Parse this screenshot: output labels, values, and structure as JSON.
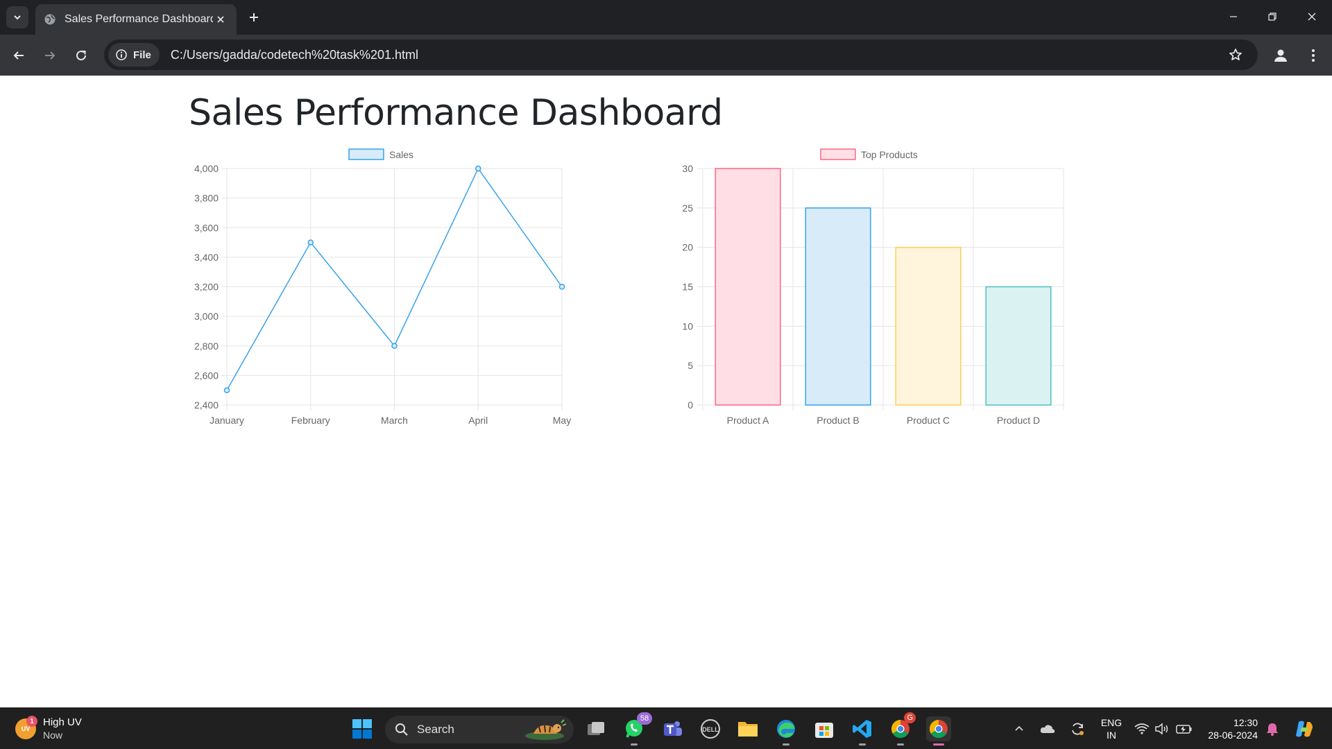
{
  "browser": {
    "tab_title": "Sales Performance Dashboard",
    "site_chip_label": "File",
    "url": "C:/Users/gadda/codetech%20task%201.html"
  },
  "page": {
    "title": "Sales Performance Dashboard"
  },
  "chart_data": [
    {
      "type": "line",
      "x": [
        "January",
        "February",
        "March",
        "April",
        "May"
      ],
      "series": [
        {
          "name": "Sales",
          "values": [
            2500,
            3500,
            2800,
            4000,
            3200
          ],
          "color": "#36a2eb"
        }
      ],
      "ylim": [
        2400,
        4000
      ],
      "yticks": [
        "4,000",
        "3,800",
        "3,600",
        "3,400",
        "3,200",
        "3,000",
        "2,800",
        "2,600",
        "2,400"
      ],
      "legend": "top-center",
      "grid": true
    },
    {
      "type": "bar",
      "categories": [
        "Product A",
        "Product B",
        "Product C",
        "Product D"
      ],
      "series": [
        {
          "name": "Top Products",
          "values": [
            30,
            25,
            20,
            15
          ]
        }
      ],
      "bar_colors": [
        "#ff6384",
        "#36a2eb",
        "#ffce56",
        "#4bc0c0"
      ],
      "bar_fills": [
        "#ffdfe5",
        "#d7ebf9",
        "#fff4dc",
        "#dbf2f2"
      ],
      "ylim": [
        0,
        30
      ],
      "yticks": [
        "30",
        "25",
        "20",
        "15",
        "10",
        "5",
        "0"
      ],
      "legend": "top-center",
      "grid": true
    }
  ],
  "taskbar": {
    "weather_title": "High UV",
    "weather_sub": "Now",
    "weather_badge": "1",
    "weather_abbrev": "UV",
    "search_label": "Search",
    "whatsapp_badge": "58",
    "chrome_badge": "G",
    "lang_line1": "ENG",
    "lang_line2": "IN",
    "time": "12:30",
    "date": "28-06-2024"
  }
}
